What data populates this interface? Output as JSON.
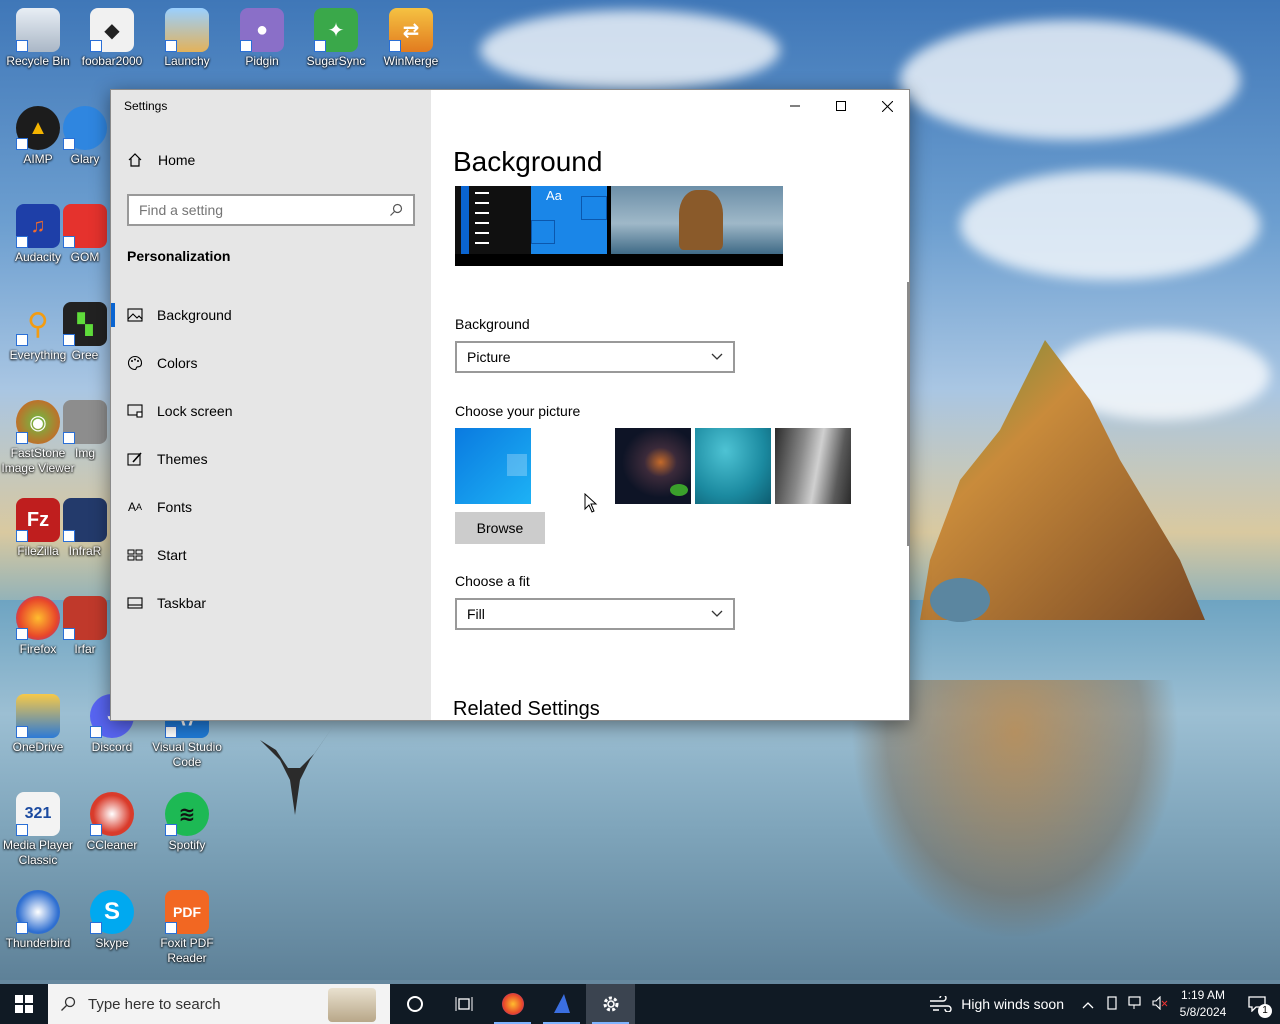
{
  "desktop": {
    "icons": [
      {
        "label": "Recycle Bin"
      },
      {
        "label": "foobar2000"
      },
      {
        "label": "Launchy"
      },
      {
        "label": "Pidgin"
      },
      {
        "label": "SugarSync"
      },
      {
        "label": "WinMerge"
      },
      {
        "label": "AIMP"
      },
      {
        "label": "Glary"
      },
      {
        "label": "Audacity"
      },
      {
        "label": "GOM"
      },
      {
        "label": "Everything"
      },
      {
        "label": "Gree"
      },
      {
        "label": "FastStone Image Viewer"
      },
      {
        "label": "Img"
      },
      {
        "label": "FileZilla"
      },
      {
        "label": "InfraR"
      },
      {
        "label": "Firefox"
      },
      {
        "label": "Irfar"
      },
      {
        "label": "OneDrive"
      },
      {
        "label": "Discord"
      },
      {
        "label": "Visual Studio Code"
      },
      {
        "label": "Media Player Classic"
      },
      {
        "label": "CCleaner"
      },
      {
        "label": "Spotify"
      },
      {
        "label": "Thunderbird"
      },
      {
        "label": "Skype"
      },
      {
        "label": "Foxit PDF Reader"
      }
    ]
  },
  "window": {
    "title": "Settings",
    "nav": {
      "home_label": "Home",
      "search_placeholder": "Find a setting",
      "section_heading": "Personalization",
      "items": [
        {
          "label": "Background",
          "active": true
        },
        {
          "label": "Colors"
        },
        {
          "label": "Lock screen"
        },
        {
          "label": "Themes"
        },
        {
          "label": "Fonts"
        },
        {
          "label": "Start"
        },
        {
          "label": "Taskbar"
        }
      ]
    },
    "content": {
      "page_title": "Background",
      "preview_sample_text": "Aa",
      "background_label": "Background",
      "background_value": "Picture",
      "choose_picture_label": "Choose your picture",
      "browse_label": "Browse",
      "choose_fit_label": "Choose a fit",
      "fit_value": "Fill",
      "related_heading": "Related Settings"
    }
  },
  "taskbar": {
    "search_placeholder": "Type here to search",
    "weather_text": "High winds soon",
    "time": "1:19 AM",
    "date": "5/8/2024",
    "notification_count": "1",
    "accent": "#0a64d1"
  }
}
